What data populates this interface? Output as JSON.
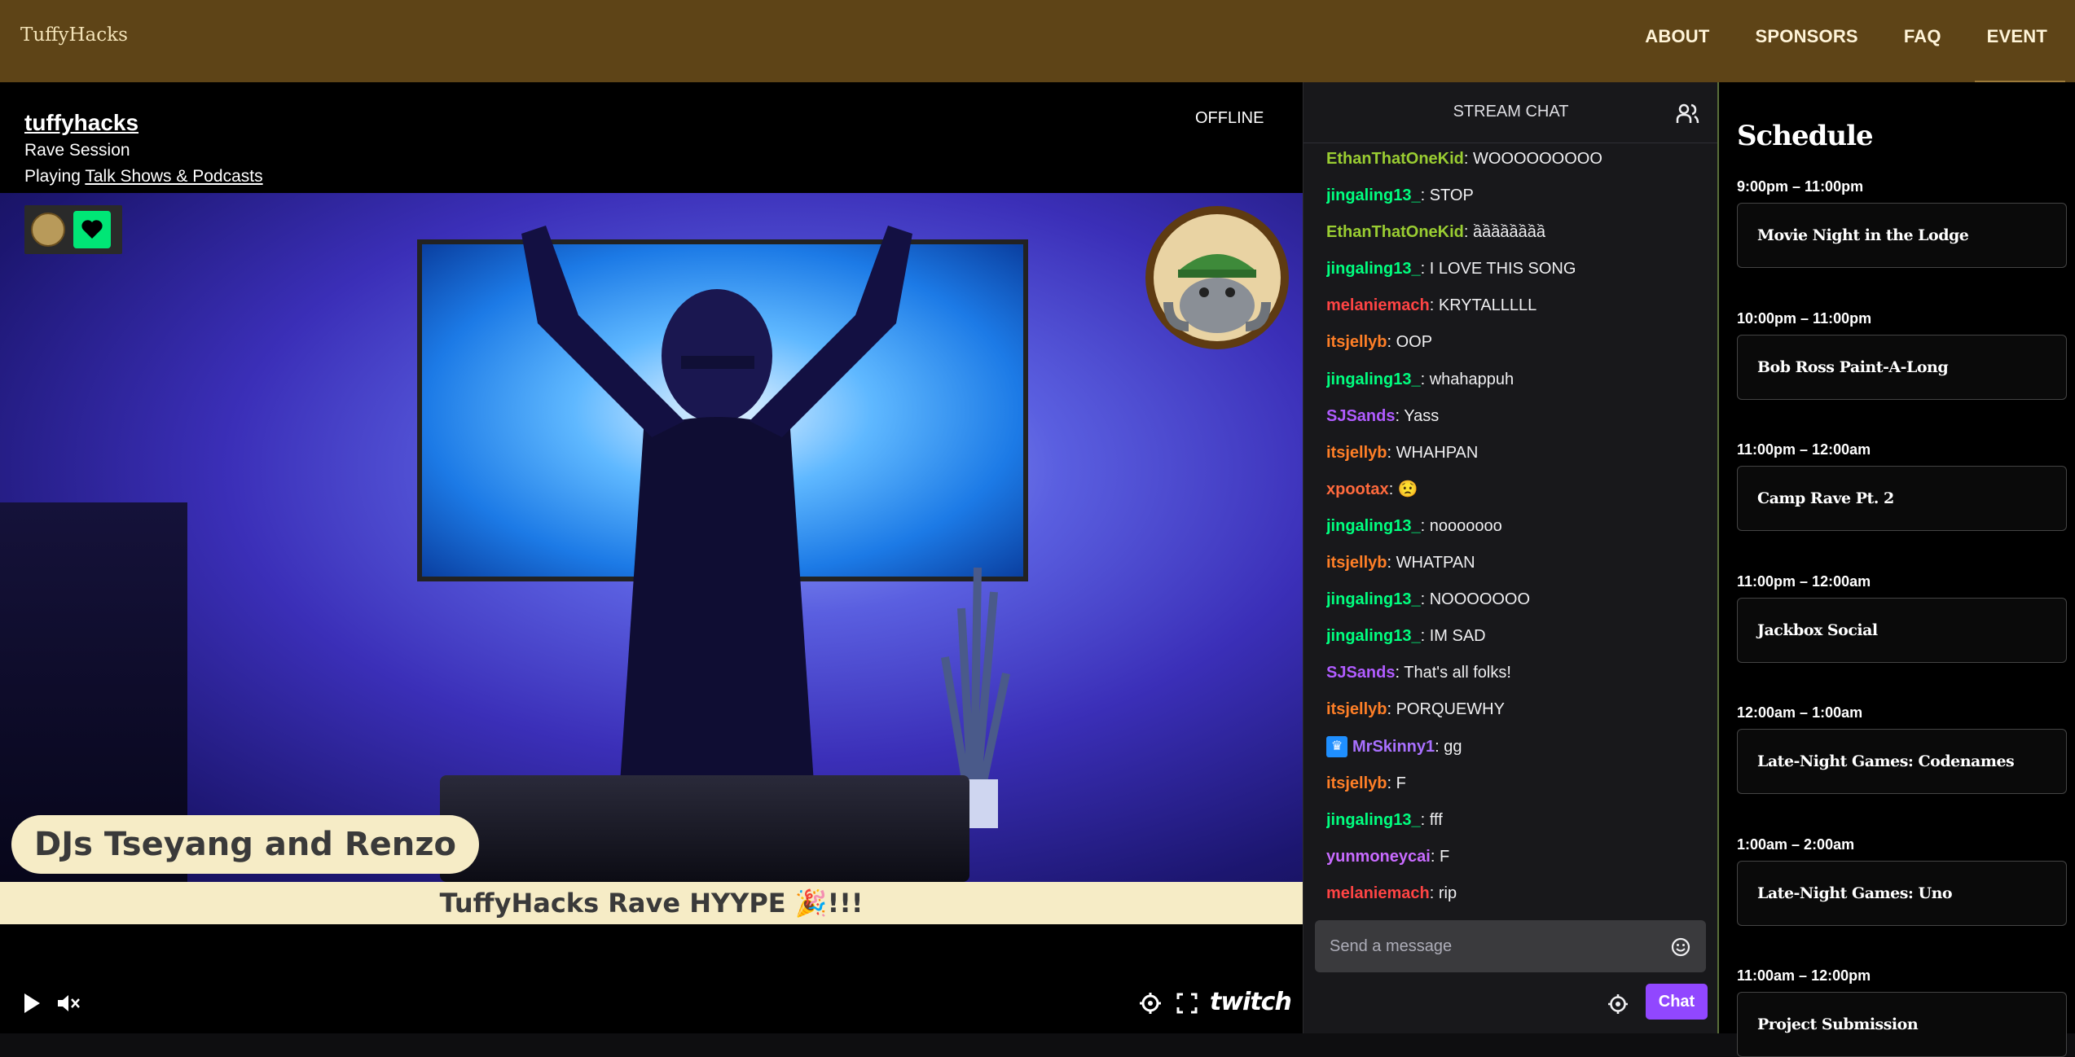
{
  "nav": {
    "brand": "TuffyHacks",
    "links": [
      "ABOUT",
      "SPONSORS",
      "FAQ",
      "EVENT"
    ]
  },
  "player": {
    "channel": "tuffyhacks",
    "title": "Rave Session",
    "playing_prefix": "Playing ",
    "category": "Talk Shows & Podcasts",
    "status": "OFFLINE",
    "lower_third": "DJs Tseyang and Renzo",
    "banner": "TuffyHacks Rave HYYPE 🎉!!!",
    "watermark": "twitch"
  },
  "chat": {
    "title": "STREAM CHAT",
    "placeholder": "Send a message",
    "send_label": "Chat",
    "messages": [
      {
        "user": "EthanThatOneKid",
        "color": "#9acd32",
        "text": ": WOOOOOOOOO"
      },
      {
        "user": "jingaling13_",
        "color": "#00ff7f",
        "text": ": STOP"
      },
      {
        "user": "EthanThatOneKid",
        "color": "#9acd32",
        "text": ": ầầầầầầầầ"
      },
      {
        "user": "jingaling13_",
        "color": "#00ff7f",
        "text": ": I LOVE THIS SONG"
      },
      {
        "user": "melaniemach",
        "color": "#ff4444",
        "text": ": KRYTALLLLL"
      },
      {
        "user": "itsjellyb",
        "color": "#ff7f27",
        "text": ": OOP"
      },
      {
        "user": "jingaling13_",
        "color": "#00ff7f",
        "text": ": whahappuh"
      },
      {
        "user": "SJSands",
        "color": "#b05cff",
        "text": ": Yass"
      },
      {
        "user": "itsjellyb",
        "color": "#ff7f27",
        "text": ": WHAHPAN"
      },
      {
        "user": "xpootax",
        "color": "#ff6a3d",
        "text": ": 😟"
      },
      {
        "user": "jingaling13_",
        "color": "#00ff7f",
        "text": ": nooooooo"
      },
      {
        "user": "itsjellyb",
        "color": "#ff7f27",
        "text": ": WHATPAN"
      },
      {
        "user": "jingaling13_",
        "color": "#00ff7f",
        "text": ": NOOOOOOO"
      },
      {
        "user": "jingaling13_",
        "color": "#00ff7f",
        "text": ": IM SAD"
      },
      {
        "user": "SJSands",
        "color": "#b05cff",
        "text": ": That's all folks!"
      },
      {
        "user": "itsjellyb",
        "color": "#ff7f27",
        "text": ": PORQUEWHY"
      },
      {
        "user": "MrSkinny1",
        "color": "#a970ff",
        "text": ": gg",
        "badge": "crown-badge-icon"
      },
      {
        "user": "itsjellyb",
        "color": "#ff7f27",
        "text": ": F"
      },
      {
        "user": "jingaling13_",
        "color": "#00ff7f",
        "text": ": fff"
      },
      {
        "user": "yunmoneycai",
        "color": "#c86bff",
        "text": ": F"
      },
      {
        "user": "melaniemach",
        "color": "#ff4444",
        "text": ": rip"
      }
    ]
  },
  "schedule": {
    "title": "Schedule",
    "items": [
      {
        "time": "9:00pm – 11:00pm",
        "name": "Movie Night in the Lodge"
      },
      {
        "time": "10:00pm – 11:00pm",
        "name": "Bob Ross Paint-A-Long"
      },
      {
        "time": "11:00pm – 12:00am",
        "name": "Camp Rave Pt. 2"
      },
      {
        "time": "11:00pm – 12:00am",
        "name": "Jackbox Social"
      },
      {
        "time": "12:00am – 1:00am",
        "name": "Late-Night Games: Codenames"
      },
      {
        "time": "1:00am – 2:00am",
        "name": "Late-Night Games: Uno"
      },
      {
        "time": "11:00am – 12:00pm",
        "name": "Project Submission"
      }
    ]
  },
  "colors": {
    "nav_bg": "#5e4417",
    "chat_bg": "#18181b",
    "twitch_purple": "#9147ff",
    "banner_bg": "#f6ecc6"
  }
}
